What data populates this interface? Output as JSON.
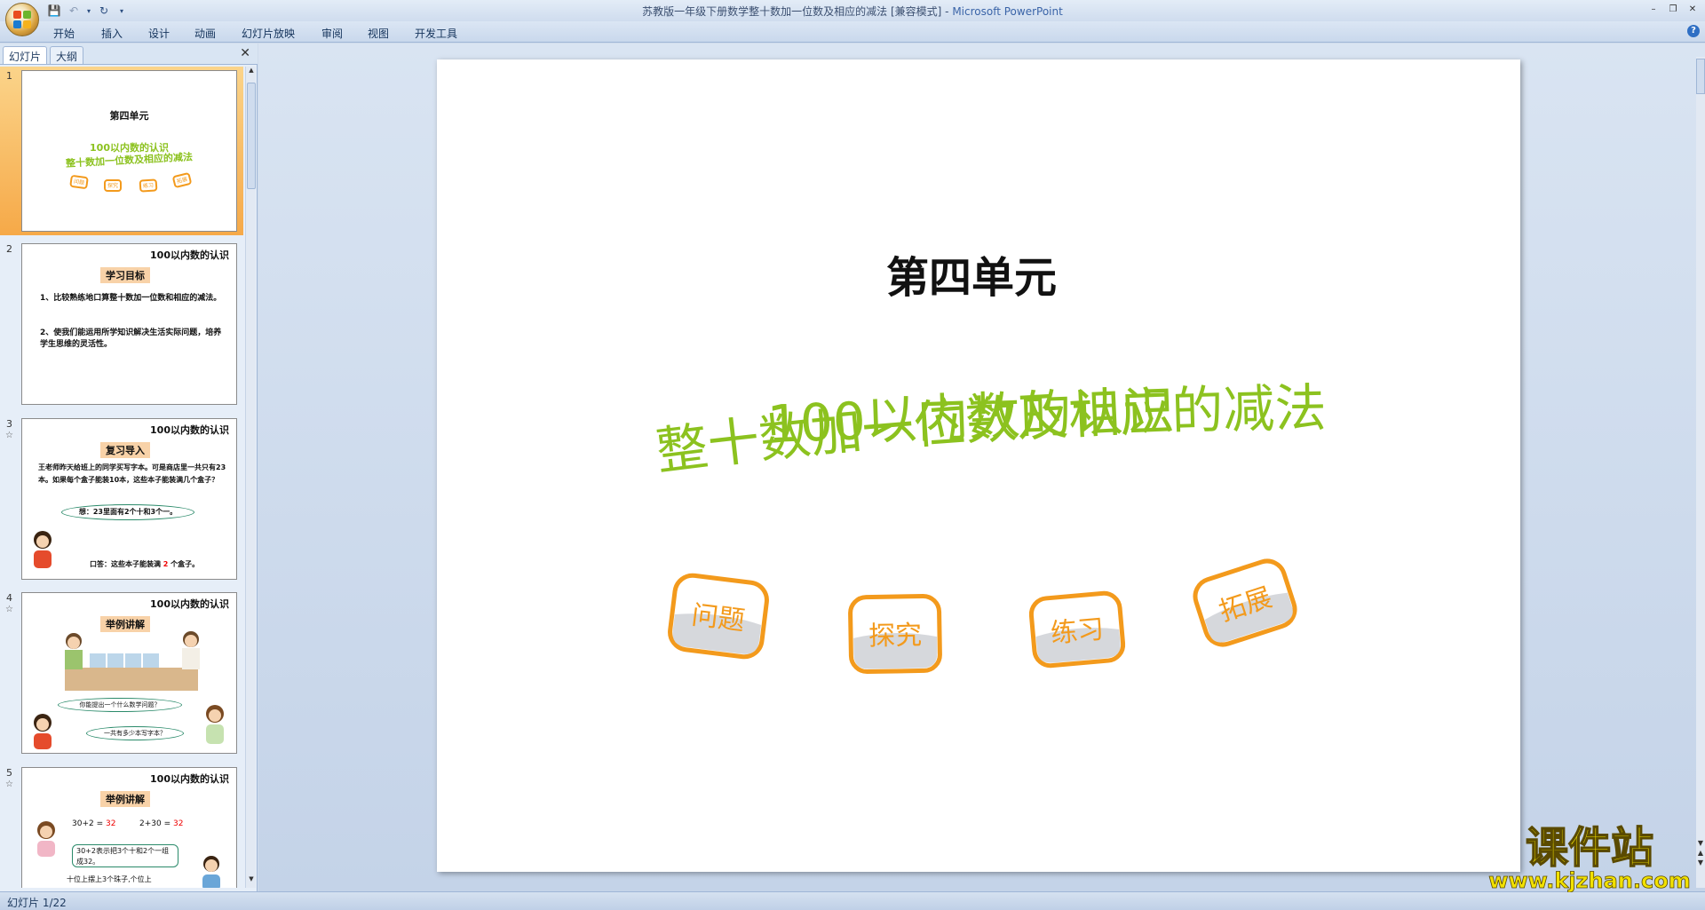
{
  "window": {
    "title": "苏教版一年级下册数学整十数加一位数及相应的减法 [兼容模式]",
    "separator": " - ",
    "app_name": "Microsoft PowerPoint"
  },
  "ribbon": {
    "tabs": [
      "开始",
      "插入",
      "设计",
      "动画",
      "幻灯片放映",
      "审阅",
      "视图",
      "开发工具"
    ]
  },
  "panel": {
    "tab_slides": "幻灯片",
    "tab_outline": "大纲"
  },
  "status": {
    "text": "幻灯片 1/22"
  },
  "slides": {
    "s1": {
      "num": "1",
      "title": "第四单元",
      "line1": "100以内数的认识",
      "line2": "整十数加一位数及相应的减法",
      "buttons": [
        "问题",
        "探究",
        "练习",
        "拓展"
      ]
    },
    "s2": {
      "num": "2",
      "header": "100以内数的认识",
      "label": "学习目标",
      "p1": "1、比较熟练地口算整十数加一位数和相应的减法。",
      "p2": "2、使我们能运用所学知识解决生活实际问题，培养学生思维的灵活性。"
    },
    "s3": {
      "num": "3",
      "star": "☆",
      "header": "100以内数的认识",
      "label": "复习导入",
      "p1": "王老师昨天给班上的同学买写字本。可是商店里一共只有23本。如果每个盒子能装10本，这些本子能装满几个盒子？",
      "bubble": "想：23里面有2个十和3个一。",
      "answer_prefix": "口答：这些本子能装满",
      "answer_num": "2",
      "answer_suffix": "个盒子。"
    },
    "s4": {
      "num": "4",
      "star": "☆",
      "header": "100以内数的认识",
      "label": "举例讲解",
      "bubble1": "你能提出一个什么数学问题？",
      "bubble2": "一共有多少本写字本？"
    },
    "s5": {
      "num": "5",
      "star": "☆",
      "header": "100以内数的认识",
      "label": "举例讲解",
      "eq1": "30+2 =",
      "eq1_ans": "32",
      "eq2": "2+30 =",
      "eq2_ans": "32",
      "note": "30+2表示把3个十和2个一组成32。",
      "note2": "十位上摆上3个珠子,个位上"
    }
  },
  "watermark": {
    "line1": "课件站",
    "line2": "www.kjzhan.com"
  },
  "colors": {
    "green": "#8cc21f",
    "orange": "#f39a1c",
    "label_bg": "#f8d2a8"
  }
}
